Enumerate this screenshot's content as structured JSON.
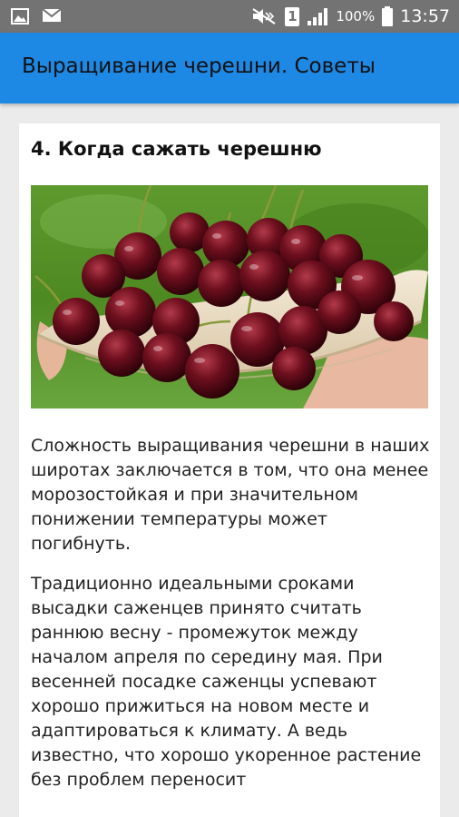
{
  "status_bar": {
    "notification_icons": [
      "image-icon",
      "mail-icon"
    ],
    "system_icons": [
      "mute-icon",
      "sim-1-icon",
      "signal-icon",
      "battery-icon"
    ],
    "sim_label": "1",
    "battery": "100%",
    "time": "13:57"
  },
  "app_bar": {
    "title": "Выращивание черешни. Советы",
    "color": "#1e88e5"
  },
  "article": {
    "heading": "4. Когда сажать черешню",
    "image": "cherries-photo",
    "paragraphs": [
      "Сложность выращивания черешни в наших широтах заключается в том, что она менее морозостойкая и при значительном понижении температуры может погибнуть.",
      "Традиционно идеальными сроками высадки саженцев принято считать раннюю весну - промежуток между началом апреля по середину мая. При весенней посадке саженцы успевают хорошо прижиться на новом месте и адаптироваться к климату. А ведь известно, что хорошо укоренное растение без проблем переносит"
    ]
  }
}
